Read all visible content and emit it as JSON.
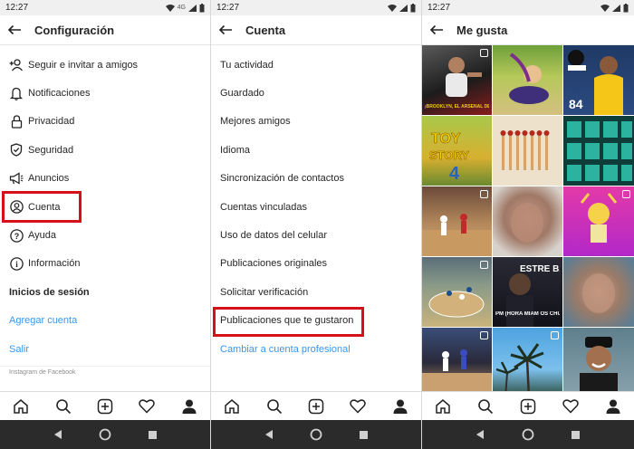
{
  "status": {
    "time": "12:27",
    "net_label": "4G"
  },
  "panel1": {
    "title": "Configuración",
    "items": [
      {
        "label": "Seguir e invitar a amigos",
        "icon": "add-person-icon"
      },
      {
        "label": "Notificaciones",
        "icon": "bell-icon"
      },
      {
        "label": "Privacidad",
        "icon": "lock-icon"
      },
      {
        "label": "Seguridad",
        "icon": "shield-icon"
      },
      {
        "label": "Anuncios",
        "icon": "megaphone-icon"
      },
      {
        "label": "Cuenta",
        "icon": "user-circle-icon"
      },
      {
        "label": "Ayuda",
        "icon": "help-circle-icon"
      },
      {
        "label": "Información",
        "icon": "info-circle-icon"
      }
    ],
    "section_logins": "Inicios de sesión",
    "add_account": "Agregar cuenta",
    "logout": "Salir",
    "footer": "Instagram de Facebook"
  },
  "panel2": {
    "title": "Cuenta",
    "items": [
      "Tu actividad",
      "Guardado",
      "Mejores amigos",
      "Idioma",
      "Sincronización de contactos",
      "Cuentas vinculadas",
      "Uso de datos del celular",
      "Publicaciones originales",
      "Solicitar verificación",
      "Publicaciones que te gustaron"
    ],
    "switch_pro": "Cambiar a cuenta profesional"
  },
  "panel3": {
    "title": "Me gusta",
    "captions": {
      "c1": "¡BROOKLYN, EL ARSENAL DE LA NBA!",
      "c3": "84",
      "c11": "ESTRE BANAN",
      "c11b": "PM (HORA MIAM OS CHUPAPIJA"
    }
  },
  "colors": {
    "accent_red": "#d4101b",
    "link_blue": "#3897f0"
  }
}
